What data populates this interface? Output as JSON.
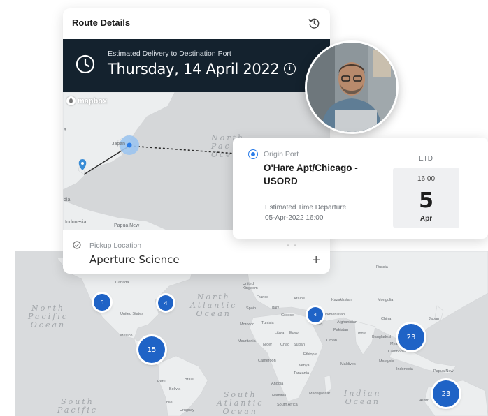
{
  "route": {
    "title": "Route Details",
    "history_icon": "history-icon",
    "delivery_label": "Estimated Delivery to Destination Port",
    "delivery_date": "Thursday, 14 April 2022",
    "info_icon": "i",
    "map_brand": "mapbox",
    "map_labels": {
      "ocean": "North\nPac\nOce",
      "japan": "Japan",
      "indonesia": "Indonesia",
      "papua": "Papua New",
      "india": "dia",
      "a": "a"
    },
    "pickup_label": "Pickup Location",
    "pickup_value": "Aperture Science",
    "pickup_dash": "- -",
    "add_symbol": "+"
  },
  "origin": {
    "label": "Origin Port",
    "name": "O'Hare Apt/Chicago - USORD",
    "departure_label": "Estimated Time Departure:",
    "departure_value": "05-Apr-2022 16:00",
    "etd_label": "ETD",
    "etd_time": "16:00",
    "etd_day": "5",
    "etd_month": "Apr"
  },
  "world_map": {
    "oceans": {
      "north_pacific": "North\nPacific\nOcean",
      "north_atlantic": "North\nAtlantic\nOcean",
      "south_pacific": "South\nPacific",
      "south_atlantic": "South\nAtlantic\nOcean",
      "indian": "Indian\nOcean"
    },
    "places": {
      "russia": "Russia",
      "canada": "Canada",
      "united_kingdom": "United\nKingdom",
      "france": "France",
      "spain": "Spain",
      "italy": "Italy",
      "greece": "Greece",
      "ukraine": "Ukraine",
      "kazakhstan": "Kazakhstan",
      "mongolia": "Mongolia",
      "china": "China",
      "japan": "Japan",
      "turkmenistan": "Turkmenistan",
      "afghanistan": "Afghanistan",
      "pakistan": "Pakistan",
      "united_states": "United States",
      "morocco": "Morocco",
      "tunisia": "Tunisia",
      "libya": "Libya",
      "egypt": "Egypt",
      "iraq": "Iraq",
      "oman": "Oman",
      "india": "India",
      "bangladesh": "Bangladesh",
      "myanmar": "Myanmar",
      "cambodia": "Cambodia",
      "malaysia": "Malaysia",
      "indonesia": "Indonesia",
      "papua": "Papua New",
      "mexico": "Mexico",
      "mauritania": "Mauritania",
      "niger": "Niger",
      "chad": "Chad",
      "sudan": "Sudan",
      "ethiopia": "Ethiopia",
      "cameroon": "Cameroon",
      "kenya": "Kenya",
      "tanzania": "Tanzania",
      "angola": "Angola",
      "namibia": "Namibia",
      "madagascar": "Madagascar",
      "south_africa": "South Africa",
      "maldives": "Maldives",
      "peru": "Peru",
      "brazil": "Brazil",
      "bolivia": "Bolivia",
      "chile": "Chile",
      "uruguay": "Uruguay",
      "australia": "Austr"
    },
    "clusters": {
      "c1": "5",
      "c2": "4",
      "c3": "4",
      "c4": "15",
      "c5": "23",
      "c6": "23"
    },
    "accent": "#1f63c6"
  }
}
